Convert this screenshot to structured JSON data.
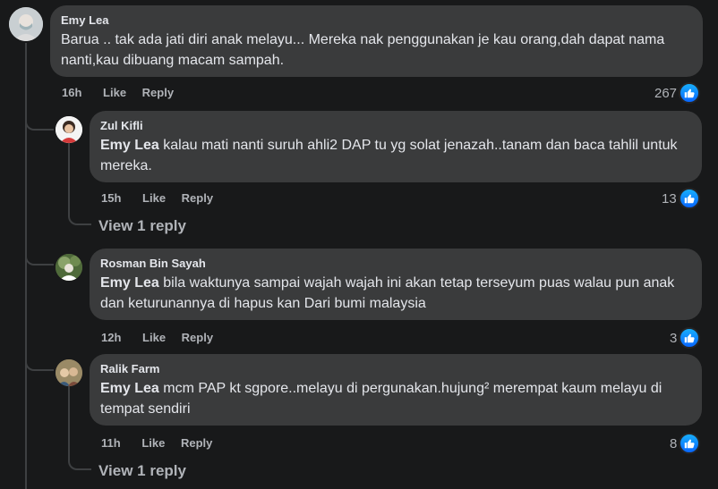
{
  "comment": {
    "author": "Emy Lea",
    "text": "Barua .. tak ada jati diri anak melayu... Mereka nak penggunakan je kau orang,dah dapat nama nanti,kau dibuang macam sampah.",
    "time": "16h",
    "like_label": "Like",
    "reply_label": "Reply",
    "reaction_count": "267"
  },
  "replies": [
    {
      "author": "Zul Kifli",
      "mention": "Emy Lea",
      "text": " kalau mati nanti suruh ahli2 DAP tu yg solat jenazah..tanam dan baca tahlil untuk mereka.",
      "time": "15h",
      "like_label": "Like",
      "reply_label": "Reply",
      "reaction_count": "13",
      "view_replies": "View 1 reply"
    },
    {
      "author": "Rosman Bin Sayah",
      "mention": "Emy Lea",
      "text": " bila waktunya sampai wajah wajah ini akan tetap terseyum puas walau pun anak dan keturunannya di hapus kan Dari bumi malaysia",
      "time": "12h",
      "like_label": "Like",
      "reply_label": "Reply",
      "reaction_count": "3"
    },
    {
      "author": "Ralik Farm",
      "mention": "Emy Lea",
      "text": " mcm PAP kt sgpore..melayu di pergunakan.hujung² merempat kaum melayu di tempat sendiri",
      "time": "11h",
      "like_label": "Like",
      "reply_label": "Reply",
      "reaction_count": "8",
      "view_replies": "View 1 reply"
    }
  ],
  "icons": {
    "reaction": "thumbs-up-icon"
  },
  "colors": {
    "like_badge": "#0866ff",
    "bubble": "#3a3b3c",
    "background": "#18191a"
  }
}
